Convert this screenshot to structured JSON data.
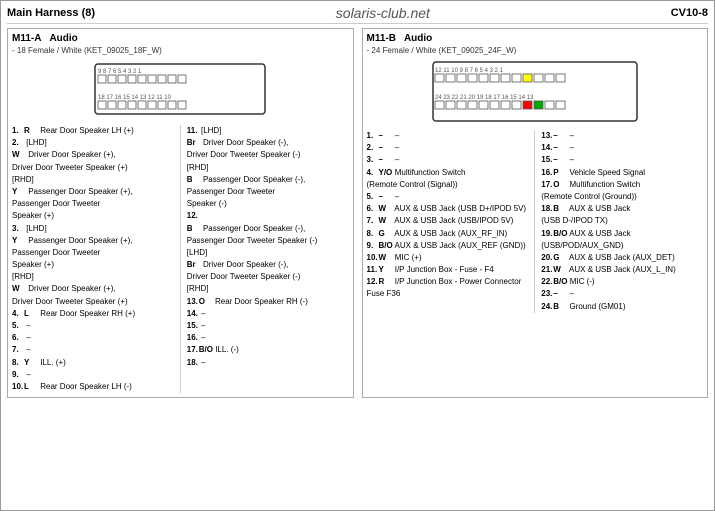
{
  "topBar": {
    "title": "Main Harness (8)",
    "website": "solaris-club.net",
    "code": "CV10-8"
  },
  "m11a": {
    "id": "M11-A",
    "section": "Audio",
    "spec": "- 18 Female / White (KET_09025_18F_W)",
    "pins_left": [
      {
        "num": "1.",
        "color": "R",
        "desc": "Rear Door Speaker LH (+)"
      },
      {
        "num": "2.",
        "color": "",
        "desc": "[LHD]"
      },
      {
        "num": "",
        "color": "W",
        "desc": "Driver Door Speaker (+),"
      },
      {
        "num": "",
        "color": "",
        "desc": "Driver Door Tweeter Speaker (+)"
      },
      {
        "num": "",
        "color": "",
        "desc": "[RHD]"
      },
      {
        "num": "Y",
        "color": "",
        "desc": "Passenger Door Speaker (+),"
      },
      {
        "num": "",
        "color": "",
        "desc": "Passenger Door Tweeter"
      },
      {
        "num": "",
        "color": "",
        "desc": "Speaker (+)"
      },
      {
        "num": "3.",
        "color": "",
        "desc": "[LHD]"
      },
      {
        "num": "Y",
        "color": "",
        "desc": "Passenger Door Speaker (+),"
      },
      {
        "num": "",
        "color": "",
        "desc": "Passenger Door Tweeter"
      },
      {
        "num": "",
        "color": "",
        "desc": "Speaker (+)"
      },
      {
        "num": "",
        "color": "",
        "desc": "[RHD]"
      },
      {
        "num": "W",
        "color": "",
        "desc": "Driver Door Speaker (+),"
      },
      {
        "num": "",
        "color": "",
        "desc": "Driver Door Tweeter Speaker (+)"
      },
      {
        "num": "4.",
        "color": "L",
        "desc": "Rear Door Speaker RH (+)"
      },
      {
        "num": "5.",
        "color": "–",
        "desc": ""
      },
      {
        "num": "6.",
        "color": "–",
        "desc": ""
      },
      {
        "num": "7.",
        "color": "–",
        "desc": ""
      },
      {
        "num": "8.",
        "color": "Y",
        "desc": "ILL. (+)"
      },
      {
        "num": "9.",
        "color": "–",
        "desc": ""
      },
      {
        "num": "10.",
        "color": "L",
        "desc": "Rear Door Speaker LH (-)"
      }
    ],
    "pins_right": [
      {
        "num": "11.",
        "color": "",
        "desc": "[LHD]"
      },
      {
        "num": "",
        "color": "Br",
        "desc": "Driver Door Speaker (-),"
      },
      {
        "num": "",
        "color": "",
        "desc": "Driver Door Tweeter Speaker (-)"
      },
      {
        "num": "",
        "color": "",
        "desc": "[RHD]"
      },
      {
        "num": "",
        "color": "B",
        "desc": "Passenger Door Speaker (-),"
      },
      {
        "num": "",
        "color": "",
        "desc": "Passenger Door Tweeter"
      },
      {
        "num": "",
        "color": "",
        "desc": "Speaker (-)"
      },
      {
        "num": "12.",
        "color": "",
        "desc": ""
      },
      {
        "num": "",
        "color": "B",
        "desc": "Passenger Door Speaker (-),"
      },
      {
        "num": "",
        "color": "",
        "desc": "Passenger Door Tweeter Speaker (-)"
      },
      {
        "num": "",
        "color": "",
        "desc": "[LHD]"
      },
      {
        "num": "",
        "color": "Br",
        "desc": "Driver Door Speaker (-),"
      },
      {
        "num": "",
        "color": "",
        "desc": "Driver Door Tweeter Speaker (-)"
      },
      {
        "num": "",
        "color": "",
        "desc": "[RHD]"
      },
      {
        "num": "13.",
        "color": "O",
        "desc": "Rear Door Speaker RH (-)"
      },
      {
        "num": "14.",
        "color": "–",
        "desc": ""
      },
      {
        "num": "15.",
        "color": "–",
        "desc": ""
      },
      {
        "num": "16.",
        "color": "–",
        "desc": ""
      },
      {
        "num": "17.",
        "color": "B/O",
        "desc": "ILL. (-)"
      },
      {
        "num": "18.",
        "color": "–",
        "desc": ""
      }
    ]
  },
  "m11b": {
    "id": "M11-B",
    "section": "Audio",
    "spec": "- 24 Female / White (KET_09025_24F_W)",
    "pins_left": [
      {
        "num": "1.",
        "color": "–",
        "desc": "–"
      },
      {
        "num": "2.",
        "color": "–",
        "desc": "–"
      },
      {
        "num": "3.",
        "color": "–",
        "desc": "–"
      },
      {
        "num": "4.",
        "color": "Y/O",
        "desc": "Multifunction Switch (Remote Control (Signal))"
      },
      {
        "num": "5.",
        "color": "–",
        "desc": "–"
      },
      {
        "num": "6.",
        "color": "W",
        "desc": "AUX & USB Jack (USB D+/IPOD 5V)"
      },
      {
        "num": "7.",
        "color": "W",
        "desc": "AUX & USB Jack (USB/IPOD 5V)"
      },
      {
        "num": "8.",
        "color": "G",
        "desc": "AUX & USB Jack (AUX_RF_IN)"
      },
      {
        "num": "9.",
        "color": "B/O",
        "desc": "AUX & USB Jack (AUX_REF (GND))"
      },
      {
        "num": "10.",
        "color": "W",
        "desc": "MIC (+)"
      },
      {
        "num": "11.",
        "color": "Y",
        "desc": "I/P Junction Box - Fuse - F4"
      },
      {
        "num": "12.",
        "color": "R",
        "desc": "I/P Junction Box - Power Connector Fuse F36"
      }
    ],
    "pins_right": [
      {
        "num": "13.",
        "color": "–",
        "desc": "–"
      },
      {
        "num": "14.",
        "color": "–",
        "desc": "–"
      },
      {
        "num": "15.",
        "color": "–",
        "desc": "–"
      },
      {
        "num": "16.",
        "color": "P",
        "desc": "Vehicle Speed Signal"
      },
      {
        "num": "17.",
        "color": "O",
        "desc": "Multifunction Switch (Remote Control (Ground))"
      },
      {
        "num": "18.",
        "color": "B",
        "desc": "AUX & USB Jack (USB D-/IPOD TX)"
      },
      {
        "num": "19.",
        "color": "B/O",
        "desc": "AUX & USB Jack (USB/POD/AUX_GND)"
      },
      {
        "num": "20.",
        "color": "G",
        "desc": "AUX & USB Jack (AUX_DET)"
      },
      {
        "num": "21.",
        "color": "W",
        "desc": "AUX & USB Jack (AUX_L_IN)"
      },
      {
        "num": "22.",
        "color": "B/O",
        "desc": "MIC (-)"
      },
      {
        "num": "23.",
        "color": "–",
        "desc": "–"
      },
      {
        "num": "24.",
        "color": "B",
        "desc": "Ground (GM01)"
      }
    ]
  }
}
